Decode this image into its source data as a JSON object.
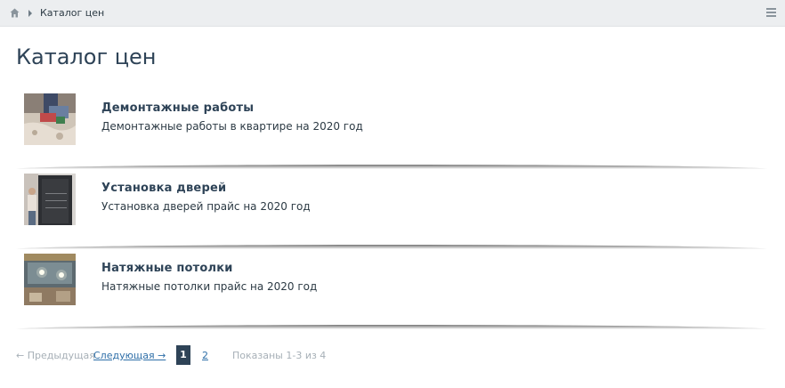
{
  "breadcrumb": {
    "home_icon": "home-icon",
    "current": "Каталог цен"
  },
  "header": {
    "menu_icon": "hamburger-menu-icon"
  },
  "page": {
    "title": "Каталог цен"
  },
  "items": [
    {
      "title": "Демонтажные работы",
      "description": "Демонтажные работы в квартире на 2020 год",
      "thumbnail": "demolition-photo"
    },
    {
      "title": "Установка дверей",
      "description": "Установка дверей прайс на 2020 год",
      "thumbnail": "door-install-photo"
    },
    {
      "title": "Натяжные потолки",
      "description": "Натяжные потолки прайс на 2020 год",
      "thumbnail": "stretch-ceiling-photo"
    }
  ],
  "pagination": {
    "prev": "← Предыдущая",
    "next": "Следующая →",
    "pages": [
      "1",
      "2"
    ],
    "active_page": "1",
    "shown": "Показаны 1-3 из 4"
  },
  "colors": {
    "accent": "#2e4357",
    "link": "#2f6fa8",
    "muted": "#a7b0b7",
    "topbar": "#eceef0"
  }
}
